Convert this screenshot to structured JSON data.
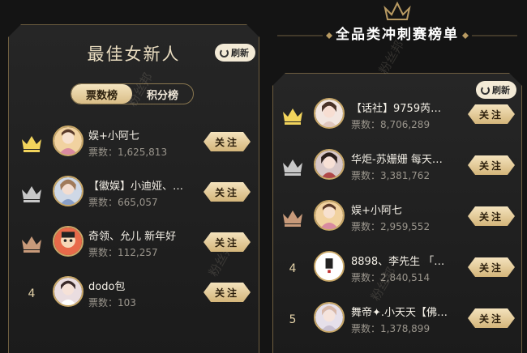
{
  "left_panel": {
    "title": "最佳女新人",
    "refresh_label": "刷新",
    "tabs": [
      {
        "label": "票数榜",
        "active": true
      },
      {
        "label": "积分榜",
        "active": false
      }
    ],
    "rows": [
      {
        "rank": "1",
        "name": "娱+小阿七",
        "votes": "票数：1,625,813",
        "follow": "关注"
      },
      {
        "rank": "2",
        "name": "【徽娱】小迪娅、…",
        "votes": "票数：665,057",
        "follow": "关注"
      },
      {
        "rank": "3",
        "name": "奇领、允儿 新年好",
        "votes": "票数：112,257",
        "follow": "关注"
      },
      {
        "rank": "4",
        "name": "dodo包",
        "votes": "票数：103",
        "follow": "关注"
      }
    ]
  },
  "right_panel": {
    "header_title": "全品类冲刺赛榜单",
    "refresh_label": "刷新",
    "rows": [
      {
        "rank": "1",
        "name": "【话社】9759芮…",
        "votes": "票数：8,706,289",
        "follow": "关注"
      },
      {
        "rank": "2",
        "name": "华炬-苏姗姗 每天…",
        "votes": "票数：3,381,762",
        "follow": "关注"
      },
      {
        "rank": "3",
        "name": "娱+小阿七",
        "votes": "票数：2,959,552",
        "follow": "关注"
      },
      {
        "rank": "4",
        "name": "8898、李先生 「…",
        "votes": "票数：2,840,514",
        "follow": "关注"
      },
      {
        "rank": "5",
        "name": "舞帝✦.小天天【佛…",
        "votes": "票数：1,378,899",
        "follow": "关注"
      }
    ]
  },
  "watermark": "粉丝邦",
  "colors": {
    "gold": "#c9a868",
    "crown_gold": "#f2d45c",
    "crown_silver": "#c8c8c8",
    "crown_bronze": "#c89a7a",
    "background": "#141414"
  }
}
